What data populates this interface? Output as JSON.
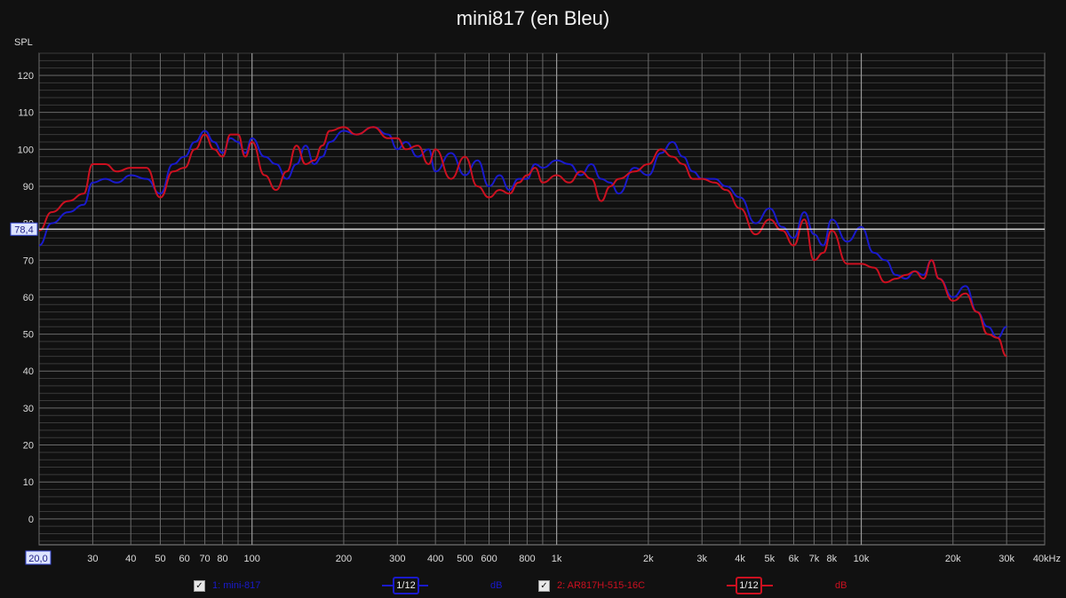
{
  "title": "mini817 (en Bleu)",
  "y_axis_label": "SPL",
  "cursor_value": "78,4",
  "x_start_value": "20,0",
  "chart_data": {
    "type": "line",
    "title": "mini817 (en Bleu)",
    "ylabel": "SPL",
    "xlabel": "",
    "x_scale": "log",
    "xlim": [
      20,
      40000
    ],
    "ylim": [
      -7,
      126
    ],
    "grid": true,
    "y_ticks": [
      0,
      10,
      20,
      30,
      40,
      50,
      60,
      70,
      80,
      90,
      100,
      110,
      120
    ],
    "x_ticks": [
      {
        "v": 30,
        "l": "30"
      },
      {
        "v": 40,
        "l": "40"
      },
      {
        "v": 50,
        "l": "50"
      },
      {
        "v": 60,
        "l": "60"
      },
      {
        "v": 70,
        "l": "70"
      },
      {
        "v": 80,
        "l": "80"
      },
      {
        "v": 100,
        "l": "100"
      },
      {
        "v": 200,
        "l": "200"
      },
      {
        "v": 300,
        "l": "300"
      },
      {
        "v": 400,
        "l": "400"
      },
      {
        "v": 500,
        "l": "500"
      },
      {
        "v": 600,
        "l": "600"
      },
      {
        "v": 800,
        "l": "800"
      },
      {
        "v": 1000,
        "l": "1k"
      },
      {
        "v": 2000,
        "l": "2k"
      },
      {
        "v": 3000,
        "l": "3k"
      },
      {
        "v": 4000,
        "l": "4k"
      },
      {
        "v": 5000,
        "l": "5k"
      },
      {
        "v": 6000,
        "l": "6k"
      },
      {
        "v": 7000,
        "l": "7k"
      },
      {
        "v": 8000,
        "l": "8k"
      },
      {
        "v": 10000,
        "l": "10k"
      },
      {
        "v": 20000,
        "l": "20k"
      },
      {
        "v": 30000,
        "l": "30k"
      },
      {
        "v": 40000,
        "l": "40kHz"
      }
    ],
    "cursor_y": 78.4,
    "series": [
      {
        "name": "1: mini-817",
        "color": "#1a1acc",
        "x": [
          20,
          22,
          25,
          28,
          30,
          33,
          36,
          40,
          45,
          50,
          55,
          60,
          65,
          70,
          75,
          80,
          85,
          90,
          95,
          100,
          110,
          120,
          130,
          140,
          150,
          160,
          170,
          180,
          200,
          220,
          250,
          280,
          300,
          320,
          350,
          380,
          400,
          450,
          500,
          550,
          600,
          650,
          700,
          750,
          800,
          850,
          900,
          1000,
          1100,
          1200,
          1300,
          1400,
          1500,
          1600,
          1800,
          2000,
          2200,
          2400,
          2600,
          2800,
          3000,
          3300,
          3600,
          4000,
          4500,
          5000,
          5500,
          6000,
          6500,
          7000,
          7500,
          8000,
          9000,
          10000,
          11000,
          12000,
          13000,
          14000,
          15000,
          16000,
          17000,
          18000,
          20000,
          22000,
          24000,
          26000,
          28000,
          30000
        ],
        "y": [
          74,
          80,
          83,
          85,
          91,
          92,
          91,
          93,
          92,
          88,
          96,
          98,
          102,
          105,
          102,
          99,
          103,
          102,
          99,
          103,
          98,
          96,
          92,
          96,
          101,
          96,
          98,
          102,
          105,
          104,
          106,
          104,
          100,
          102,
          98,
          100,
          94,
          99,
          93,
          97,
          90,
          93,
          89,
          92,
          92,
          96,
          95,
          97,
          96,
          93,
          96,
          92,
          91,
          88,
          95,
          93,
          99,
          102,
          98,
          94,
          92,
          92,
          90,
          87,
          80,
          84,
          79,
          76,
          83,
          77,
          74,
          81,
          75,
          79,
          72,
          70,
          66,
          65,
          67,
          66,
          70,
          65,
          60,
          63,
          56,
          52,
          49,
          52
        ]
      },
      {
        "name": "2: AR817H-515-16C",
        "color": "#cc1020",
        "x": [
          20,
          22,
          25,
          28,
          30,
          33,
          36,
          40,
          45,
          50,
          55,
          60,
          65,
          70,
          75,
          80,
          85,
          90,
          95,
          100,
          110,
          120,
          130,
          140,
          150,
          160,
          170,
          180,
          200,
          220,
          250,
          280,
          300,
          320,
          350,
          380,
          400,
          450,
          500,
          550,
          600,
          650,
          700,
          750,
          800,
          850,
          900,
          1000,
          1100,
          1200,
          1300,
          1400,
          1500,
          1600,
          1800,
          2000,
          2200,
          2400,
          2600,
          2800,
          3000,
          3300,
          3600,
          4000,
          4500,
          5000,
          5500,
          6000,
          6500,
          7000,
          7500,
          8000,
          9000,
          10000,
          11000,
          12000,
          13000,
          14000,
          15000,
          16000,
          17000,
          18000,
          20000,
          22000,
          24000,
          26000,
          28000,
          30000
        ],
        "y": [
          78,
          83,
          86,
          88,
          96,
          96,
          94,
          95,
          95,
          87,
          94,
          95,
          100,
          104,
          100,
          98,
          104,
          104,
          98,
          102,
          93,
          89,
          94,
          101,
          96,
          97,
          101,
          105,
          106,
          104,
          106,
          103,
          103,
          100,
          101,
          96,
          100,
          92,
          98,
          90,
          87,
          89,
          88,
          91,
          93,
          95,
          91,
          93,
          91,
          94,
          92,
          86,
          90,
          92,
          94,
          96,
          100,
          98,
          96,
          92,
          92,
          91,
          89,
          84,
          77,
          81,
          78,
          74,
          81,
          70,
          72,
          78,
          69,
          69,
          68,
          64,
          65,
          66,
          67,
          65,
          70,
          65,
          59,
          61,
          56,
          50,
          49,
          44
        ]
      }
    ]
  },
  "legend": {
    "item1_label": "1: mini-817",
    "item1_smoothing": "1/12",
    "item1_unit": "dB",
    "item1_checked": "☑",
    "item2_label": "2: AR817H-515-16C",
    "item2_smoothing": "1/12",
    "item2_unit": "dB",
    "item2_checked": "☑"
  },
  "colors": {
    "background": "#111111",
    "plot_bg": "#101010",
    "grid_major": "#6a6a6a",
    "grid_minor": "#3a3a3a",
    "series1": "#1a1acc",
    "series2": "#cc1020",
    "cursor": "#f0f0f0"
  }
}
